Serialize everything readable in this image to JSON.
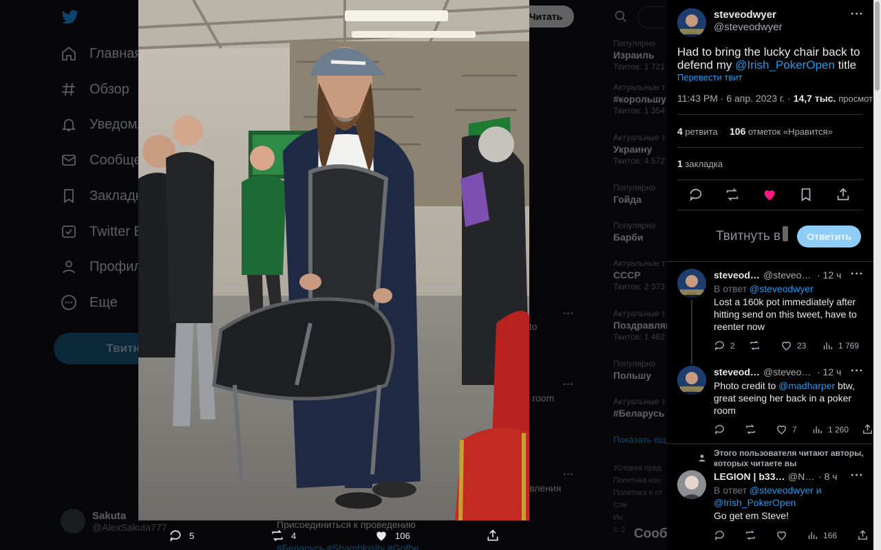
{
  "background": {
    "nav": [
      {
        "label": "Главная",
        "icon": "home-icon"
      },
      {
        "label": "Обзор",
        "icon": "hashtag-icon"
      },
      {
        "label": "Уведомл",
        "icon": "bell-icon"
      },
      {
        "label": "Сообще",
        "icon": "mail-icon"
      },
      {
        "label": "Закладк",
        "icon": "bookmark-icon"
      },
      {
        "label": "Twitter B",
        "icon": "blue-icon"
      },
      {
        "label": "Профиль",
        "icon": "profile-icon"
      },
      {
        "label": "Еще",
        "icon": "more-icon"
      }
    ],
    "tweet_button": "Твитнут",
    "read_button": "Читать",
    "user": {
      "name": "Sakuta",
      "handle": "@AlexSakuta777"
    },
    "trends": [
      {
        "context": "Популярно",
        "name": "Израиль",
        "count": "Твитов: 1 721"
      },
      {
        "context": "Актуальные т",
        "name": "#корольшу",
        "count": "Твитов: 1 354"
      },
      {
        "context": "Актуальные т",
        "name": "Украину",
        "count": "Твитов: 4 572"
      },
      {
        "context": "Популярно",
        "name": "Гойда",
        "count": ""
      },
      {
        "context": "Популярно",
        "name": "Барби",
        "count": ""
      },
      {
        "context": "Актуальные т",
        "name": "СССР",
        "count": "Твитов: 2 373"
      },
      {
        "context": "Актуальные т",
        "name": "Поздравляю",
        "count": "Твитов: 1 462"
      },
      {
        "context": "Популярно",
        "name": "Польшу",
        "count": ""
      },
      {
        "context": "Актуальные т",
        "name": "#Беларусь",
        "count": ""
      }
    ],
    "show_more": "Показать ещ",
    "footer": [
      "Условия пред",
      "Политика кон",
      "Политика в от",
      "Спе",
      "Ин",
      "© 2"
    ],
    "messages_label": "Сообщ",
    "fragments": {
      "frag1": "e to",
      "frag2": "er room",
      "frag3": "вления",
      "frag4": "Присоединиться к проведению",
      "frag5": "#Беларусь #Shamblosity #Gofbe"
    }
  },
  "media_bar": {
    "replies": "5",
    "retweets": "4",
    "likes": "106"
  },
  "tweet": {
    "author": {
      "name": "steveodwyer",
      "handle": "@steveodwyer"
    },
    "text_before": "Had to bring the lucky chair back to defend my ",
    "mention": "@Irish_PokerOpen",
    "text_after": " title",
    "translate": "Перевести твит",
    "time": "11:43 PM · 6 апр. 2023 г. ·",
    "views_count": "14,7 тыс.",
    "views_label": "просмотров",
    "retweets_count": "4",
    "retweets_label": "ретвита",
    "likes_count": "106",
    "likes_label": "отметок «Нравится»",
    "bookmarks_count": "1",
    "bookmarks_label": "закладка"
  },
  "reply_box": {
    "placeholder": "Твитнуть в",
    "button": "Ответить"
  },
  "replies": [
    {
      "name": "steveodwyer",
      "handle": "@steveodwyer",
      "time": "· 12 ч",
      "in_reply_to_prefix": "В ответ ",
      "in_reply_to": "@steveodwyer",
      "text": "Lost a 160k pot immediately after hitting send on this tweet, have to reenter now",
      "replies": "2",
      "retweets": "",
      "likes": "23",
      "views": "1 769"
    },
    {
      "name": "steveodwyer",
      "handle": "@steveodwyer",
      "time": "· 12 ч",
      "text_before": "Photo credit to ",
      "mention": "@madharper",
      "text_after": " btw, great seeing her back in a poker room",
      "replies": "",
      "retweets": "",
      "likes": "7",
      "views": "1 260"
    },
    {
      "social_context": "Этого пользователя читают авторы, которых читаете вы",
      "name": "LEGION | b33n...",
      "handle": "@NFT...",
      "time": "· 8 ч",
      "in_reply_to_prefix": "В ответ ",
      "in_reply_to": "@steveodwyer и @Irish_PokerOpen",
      "text": "Go get em Steve!",
      "replies": "",
      "retweets": "",
      "likes": "",
      "views": "166"
    }
  ]
}
